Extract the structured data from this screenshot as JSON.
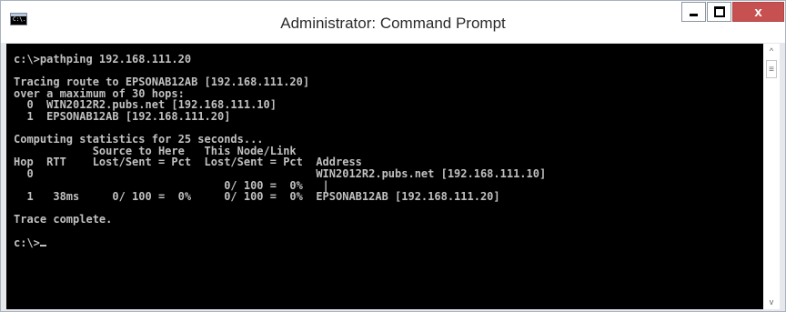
{
  "window": {
    "title": "Administrator: Command Prompt",
    "icon_label": "C:\\."
  },
  "controls": {
    "minimize": "minimize",
    "maximize": "maximize",
    "close": "x"
  },
  "console": {
    "text": "c:\\>pathping 192.168.111.20\n\nTracing route to EPSONAB12AB [192.168.111.20]\nover a maximum of 30 hops:\n  0  WIN2012R2.pubs.net [192.168.111.10]\n  1  EPSONAB12AB [192.168.111.20]\n\nComputing statistics for 25 seconds...\n            Source to Here   This Node/Link\nHop  RTT    Lost/Sent = Pct  Lost/Sent = Pct  Address\n  0                                           WIN2012R2.pubs.net [192.168.111.10]\n                                0/ 100 =  0%   |\n  1   38ms     0/ 100 =  0%     0/ 100 =  0%  EPSONAB12AB [192.168.111.20]\n\nTrace complete.\n\nc:\\>"
  },
  "scrollbar": {
    "up": "^",
    "down": "v",
    "thumb": "≡"
  }
}
